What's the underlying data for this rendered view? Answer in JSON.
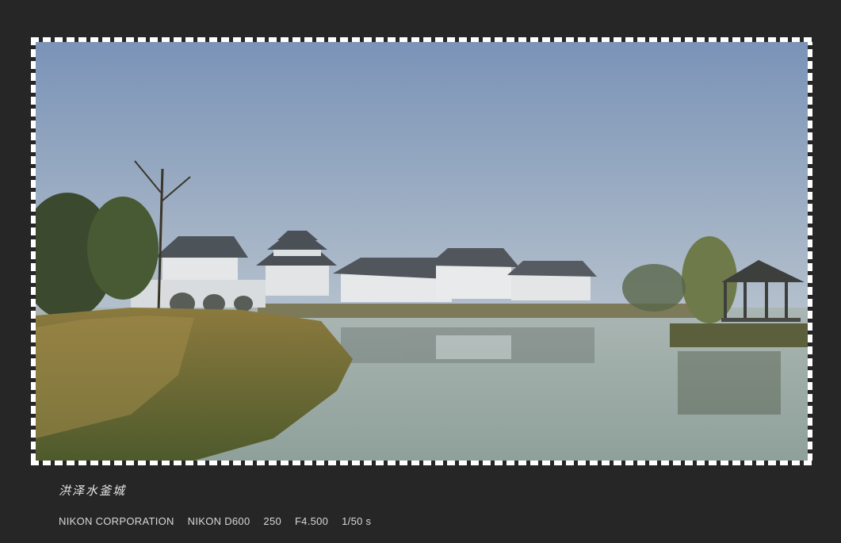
{
  "photo": {
    "subject": "lakeside-scene",
    "colors": {
      "sky_top": "#7f97b9",
      "sky_bottom": "#b6c2cd",
      "water": "#9aa9a5",
      "reeds": "#8a7a3a",
      "roof": "#4e5459",
      "wall": "#e6e8ea",
      "tree": "#3e4a30"
    }
  },
  "caption": {
    "title": "洪泽水釜城"
  },
  "exif": {
    "maker": "NIKON CORPORATION",
    "model": "NIKON D600",
    "iso": "250",
    "aperture": "F4.500",
    "shutter": "1/50 s"
  }
}
